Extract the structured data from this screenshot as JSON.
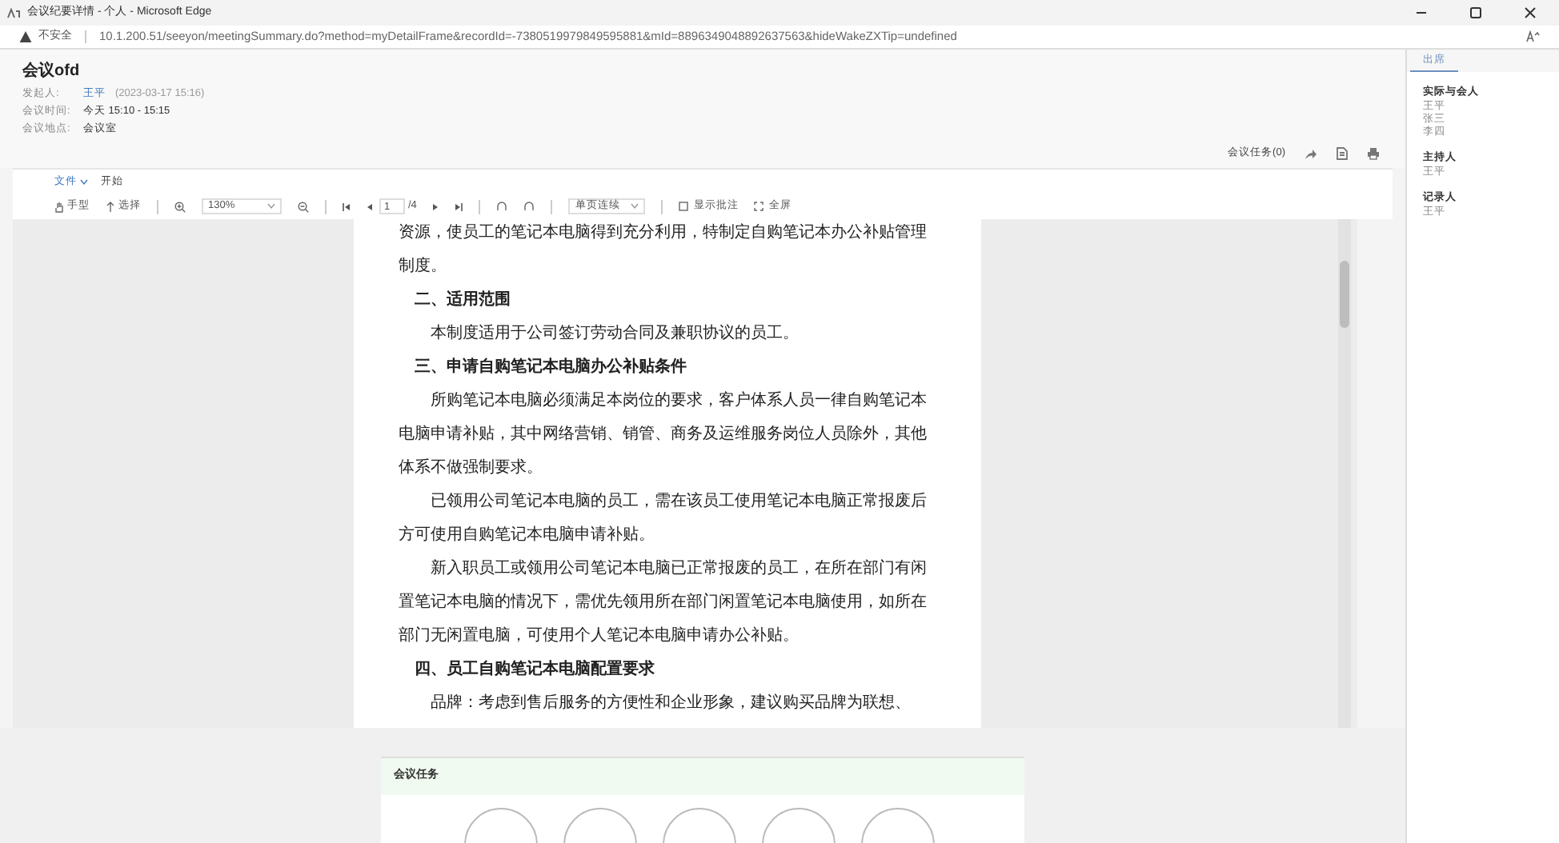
{
  "window": {
    "title": "会议纪要详情 - 个人 - Microsoft Edge"
  },
  "address_bar": {
    "security": "不安全",
    "url": "10.1.200.51/seeyon/meetingSummary.do?method=myDetailFrame&recordId=-7380519979849595881&mId=8896349048892637563&hideWakeZXTip=undefined"
  },
  "header": {
    "title": "会议ofd",
    "fields": [
      {
        "label": "发起人:",
        "value": "王平",
        "note": "(2023-03-17 15:16)"
      },
      {
        "label": "会议时间:",
        "value": "今天 15:10 - 15:15"
      },
      {
        "label": "会议地点:",
        "value": "会议室"
      }
    ],
    "task_link": "会议任务(0)"
  },
  "menu": [
    {
      "label": "文件",
      "dropdown": true
    },
    {
      "label": "开始",
      "dropdown": false
    }
  ],
  "toolbar": {
    "hand": "手型",
    "select": "选择",
    "zoom": "130%",
    "page": "1",
    "page_total": "/4",
    "view_mode": "单页连续",
    "annotations": "显示批注",
    "fullscreen": "全屏"
  },
  "document": [
    {
      "kind": "para",
      "indent": false,
      "text": "资源，使员工的笔记本电脑得到充分利用，特制定自购笔记本办公补贴管理制度。"
    },
    {
      "kind": "heading",
      "text": "二、适用范围"
    },
    {
      "kind": "para",
      "indent": true,
      "text": "本制度适用于公司签订劳动合同及兼职协议的员工。"
    },
    {
      "kind": "heading",
      "text": "三、申请自购笔记本电脑办公补贴条件"
    },
    {
      "kind": "para",
      "indent": true,
      "text": "所购笔记本电脑必须满足本岗位的要求，客户体系人员一律自购笔记本电脑申请补贴，其中网络营销、销管、商务及运维服务岗位人员除外，其他体系不做强制要求。"
    },
    {
      "kind": "para",
      "indent": true,
      "text": "已领用公司笔记本电脑的员工，需在该员工使用笔记本电脑正常报废后方可使用自购笔记本电脑申请补贴。"
    },
    {
      "kind": "para",
      "indent": true,
      "text": "新入职员工或领用公司笔记本电脑已正常报废的员工，在所在部门有闲置笔记本电脑的情况下，需优先领用所在部门闲置笔记本电脑使用，如所在部门无闲置电脑，可使用个人笔记本电脑申请办公补贴。"
    },
    {
      "kind": "heading",
      "text": "四、员工自购笔记本电脑配置要求"
    },
    {
      "kind": "para",
      "indent": true,
      "text": "品牌：考虑到售后服务的方便性和企业形象，建议购买品牌为联想、"
    }
  ],
  "tasks_card": {
    "title": "会议任务"
  },
  "side_panel": {
    "tabs": [
      {
        "label": "出席",
        "selected": true
      }
    ],
    "groups": [
      {
        "title": "实际与会人",
        "people": [
          "王平",
          "张三",
          "李四"
        ]
      },
      {
        "title": "主持人",
        "people": [
          "王平"
        ]
      },
      {
        "title": "记录人",
        "people": [
          "王平"
        ]
      }
    ]
  }
}
